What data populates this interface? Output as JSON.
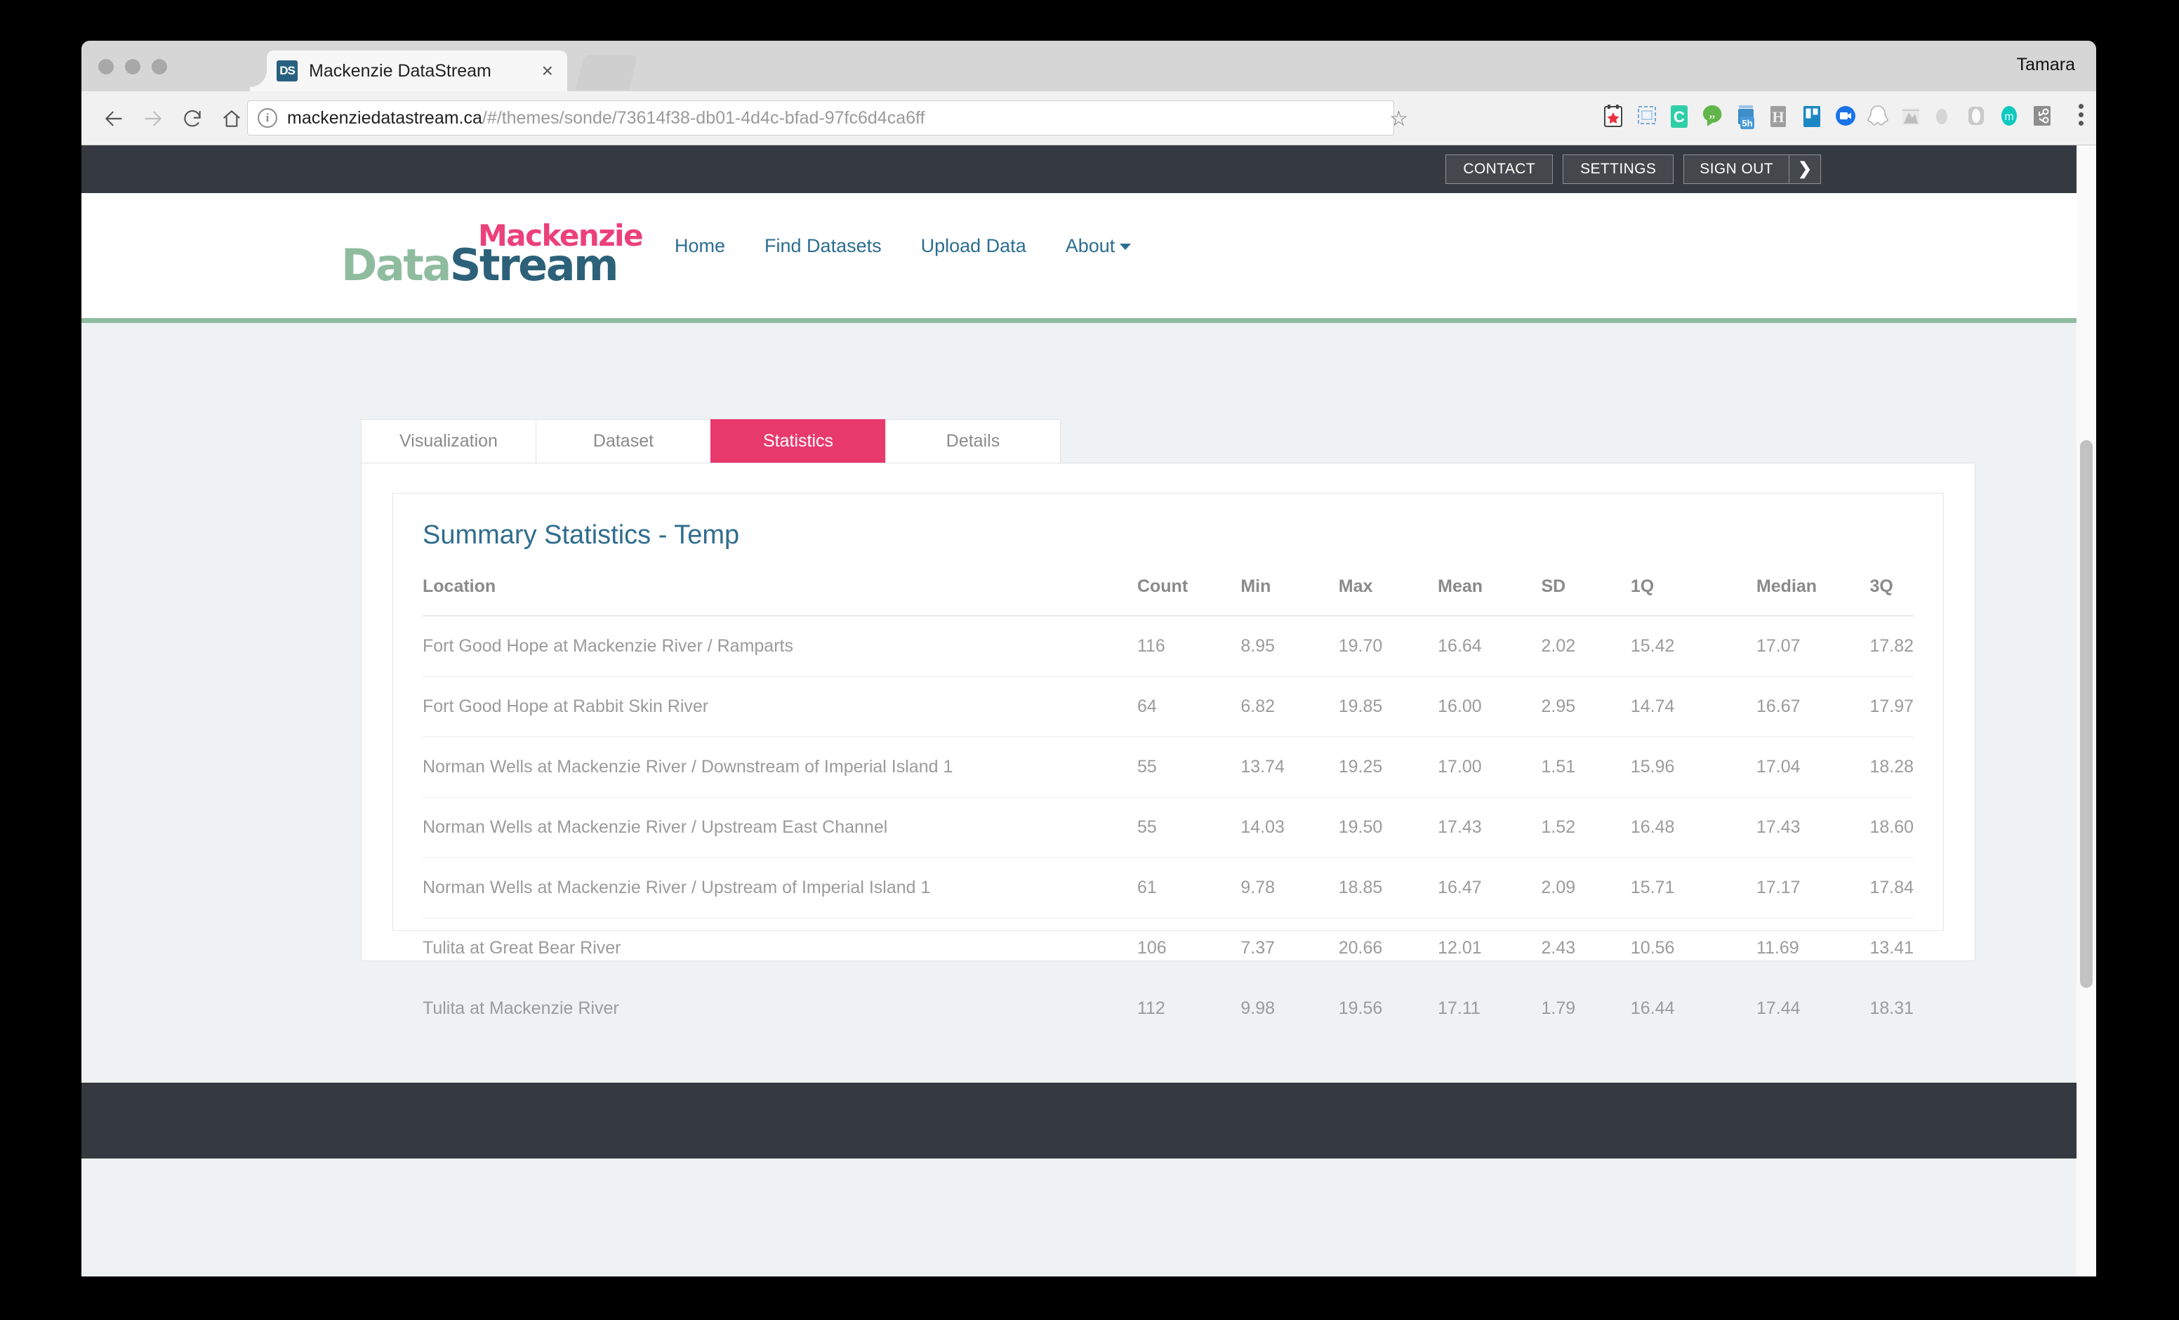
{
  "browser": {
    "window_user_label": "Tamara",
    "tab": {
      "favicon_text": "DS",
      "title": "Mackenzie DataStream",
      "close_label": "×"
    },
    "new_tab_name": "new-tab-button",
    "omnibox": {
      "info_icon": "site-info-icon",
      "url_host": "mackenziedatastream.ca",
      "url_path": "/#/themes/sonde/73614f38-db01-4d4c-bfad-97fc6d4ca6ff"
    },
    "nav": {
      "back": "back-arrow-icon",
      "forward": "forward-arrow-icon",
      "reload": "reload-icon",
      "home": "home-icon"
    },
    "bookmark_star": "☆",
    "menu": "chrome-menu-icon",
    "extensions": [
      "calendar-extension-icon",
      "screenshot-extension-icon",
      "c-extension-icon",
      "quote-extension-icon",
      "5h-timer-extension-icon",
      "h-extension-icon",
      "trello-extension-icon",
      "video-extension-icon",
      "ghost-extension-icon",
      "map-extension-icon",
      "grey-dot-extension-icon",
      "oval-extension-icon",
      "m-extension-icon",
      "hubspot-extension-icon"
    ]
  },
  "utility_bar": {
    "contact_label": "CONTACT",
    "settings_label": "SETTINGS",
    "signout_label": "SIGN OUT",
    "signout_arrow": "❯"
  },
  "site_header": {
    "logo": {
      "mackenzie": "Mackenzie",
      "data": "Data",
      "stream": "Stream",
      "color_pink": "#ec407a",
      "color_green": "#8fbc9f",
      "color_teal": "#2c6179"
    },
    "nav": [
      {
        "label": "Home",
        "caret": false
      },
      {
        "label": "Find Datasets",
        "caret": false
      },
      {
        "label": "Upload Data",
        "caret": false
      },
      {
        "label": "About",
        "caret": true
      }
    ]
  },
  "tabs": [
    {
      "label": "Visualization",
      "active": false
    },
    {
      "label": "Dataset",
      "active": false
    },
    {
      "label": "Statistics",
      "active": true
    },
    {
      "label": "Details",
      "active": false
    }
  ],
  "panel": {
    "title": "Summary Statistics - Temp",
    "accent_color": "#e8396d",
    "title_color": "#2f6d8e"
  },
  "chart_data": {
    "type": "table",
    "title": "Summary Statistics - Temp",
    "columns": [
      "Location",
      "Count",
      "Min",
      "Max",
      "Mean",
      "SD",
      "1Q",
      "Median",
      "3Q"
    ],
    "rows": [
      [
        "Fort Good Hope at Mackenzie River / Ramparts",
        "116",
        "8.95",
        "19.70",
        "16.64",
        "2.02",
        "15.42",
        "17.07",
        "17.82"
      ],
      [
        "Fort Good Hope at Rabbit Skin River",
        "64",
        "6.82",
        "19.85",
        "16.00",
        "2.95",
        "14.74",
        "16.67",
        "17.97"
      ],
      [
        "Norman Wells at Mackenzie River / Downstream of Imperial Island 1",
        "55",
        "13.74",
        "19.25",
        "17.00",
        "1.51",
        "15.96",
        "17.04",
        "18.28"
      ],
      [
        "Norman Wells at Mackenzie River / Upstream East Channel",
        "55",
        "14.03",
        "19.50",
        "17.43",
        "1.52",
        "16.48",
        "17.43",
        "18.60"
      ],
      [
        "Norman Wells at Mackenzie River / Upstream of Imperial Island 1",
        "61",
        "9.78",
        "18.85",
        "16.47",
        "2.09",
        "15.71",
        "17.17",
        "17.84"
      ],
      [
        "Tulita at Great Bear River",
        "106",
        "7.37",
        "20.66",
        "12.01",
        "2.43",
        "10.56",
        "11.69",
        "13.41"
      ],
      [
        "Tulita at Mackenzie River",
        "112",
        "9.98",
        "19.56",
        "17.11",
        "1.79",
        "16.44",
        "17.44",
        "18.31"
      ]
    ]
  }
}
